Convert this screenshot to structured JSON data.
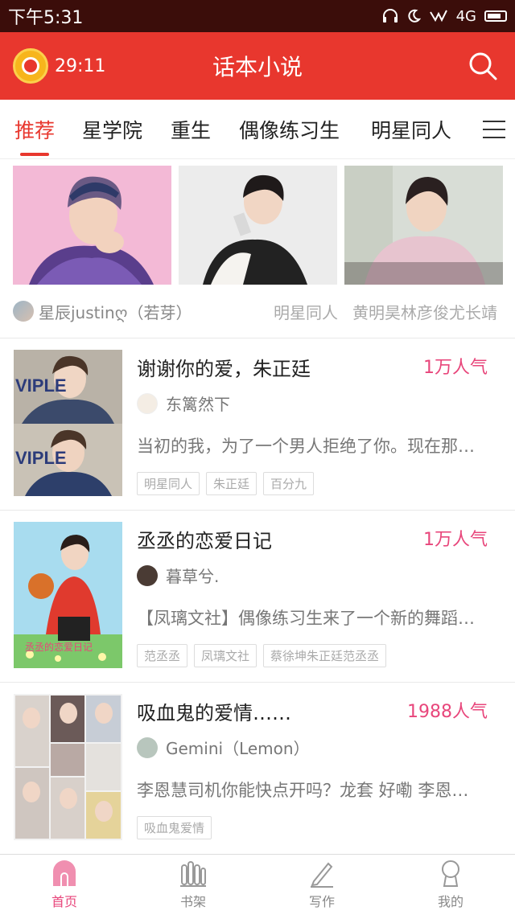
{
  "status_bar": {
    "time": "下午5:31",
    "network": "4G"
  },
  "header": {
    "timer": "29:11",
    "title": "话本小说"
  },
  "tabs": [
    {
      "label": "推荐",
      "active": true
    },
    {
      "label": "星学院",
      "active": false
    },
    {
      "label": "重生",
      "active": false
    },
    {
      "label": "偶像练习生",
      "active": false
    },
    {
      "label": "明星同人",
      "active": false
    }
  ],
  "banner": {
    "author": "星辰justinღ（若芽）",
    "category": "明星同人",
    "tags": "黄明昊林彦俊尤长靖"
  },
  "books": [
    {
      "title": "谢谢你的爱，朱正廷",
      "popularity": "1万人气",
      "author": "东篱然下",
      "summary": "当初的我，为了一个男人拒绝了你。现在那…",
      "tags": [
        "明星同人",
        "朱正廷",
        "百分九"
      ]
    },
    {
      "title": "丞丞的恋爱日记",
      "popularity": "1万人气",
      "author": "暮草兮.",
      "summary": "【凤璃文社】偶像练习生来了一个新的舞蹈…",
      "tags": [
        "范丞丞",
        "凤璃文社",
        "蔡徐坤朱正廷范丞丞"
      ]
    },
    {
      "title": "吸血鬼的爱情……",
      "popularity": "1988人气",
      "author": "Gemini（Lemon）",
      "summary": "李恩慧司机你能快点开吗？龙套 好嘞 李恩…",
      "tags": [
        "吸血鬼爱情"
      ]
    }
  ],
  "bottom_nav": [
    {
      "label": "首页",
      "icon": "home-icon",
      "active": true
    },
    {
      "label": "书架",
      "icon": "bookshelf-icon",
      "active": false
    },
    {
      "label": "写作",
      "icon": "pen-icon",
      "active": false
    },
    {
      "label": "我的",
      "icon": "profile-icon",
      "active": false
    }
  ],
  "colors": {
    "brand": "#e8372e",
    "popularity": "#e8467b",
    "status_bar": "#3b0d0a"
  }
}
